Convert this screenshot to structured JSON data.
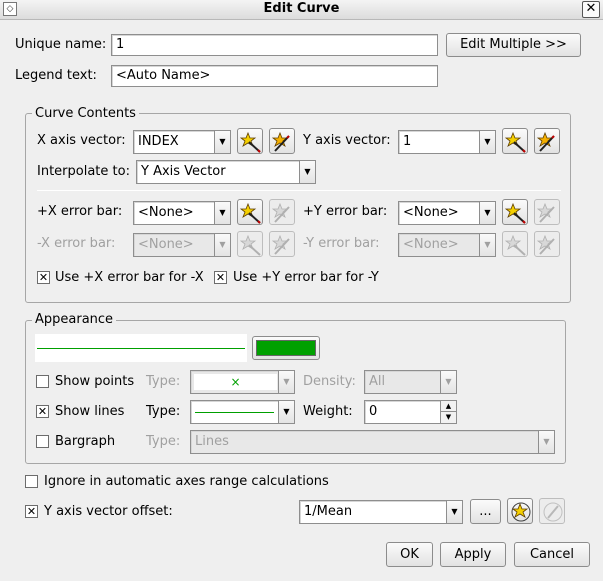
{
  "window": {
    "title": "Edit Curve"
  },
  "general": {
    "unique_name_label": "Unique name:",
    "unique_name_value": "1",
    "edit_multiple_label": "Edit Multiple >>",
    "legend_text_label": "Legend text:",
    "legend_text_value": "<Auto Name>"
  },
  "curve_contents": {
    "title": "Curve Contents",
    "x_axis_label": "X axis vector:",
    "x_axis_value": "INDEX",
    "y_axis_label": "Y axis vector:",
    "y_axis_value": "1",
    "interpolate_label": "Interpolate to:",
    "interpolate_value": "Y Axis Vector",
    "plus_x_error_label": "+X error bar:",
    "plus_x_error_value": "<None>",
    "plus_y_error_label": "+Y error bar:",
    "plus_y_error_value": "<None>",
    "minus_x_error_label": "-X error bar:",
    "minus_x_error_value": "<None>",
    "minus_y_error_label": "-Y error bar:",
    "minus_y_error_value": "<None>",
    "use_plus_x_label": "Use +X error bar for -X",
    "use_plus_x_checked": true,
    "use_plus_y_label": "Use +Y error bar for -Y",
    "use_plus_y_checked": true
  },
  "appearance": {
    "title": "Appearance",
    "color": "#00a000",
    "show_points_label": "Show points",
    "show_points_checked": false,
    "points_type_label": "Type:",
    "points_type_symbol": "×",
    "density_label": "Density:",
    "density_value": "All",
    "show_lines_label": "Show lines",
    "show_lines_checked": true,
    "lines_type_label": "Type:",
    "weight_label": "Weight:",
    "weight_value": "0",
    "bargraph_label": "Bargraph",
    "bargraph_checked": false,
    "bargraph_type_label": "Type:",
    "bargraph_type_value": "Lines"
  },
  "options": {
    "ignore_label": "Ignore in automatic axes range calculations",
    "ignore_checked": false,
    "y_offset_label": "Y axis vector offset:",
    "y_offset_checked": true,
    "y_offset_value": "1/Mean",
    "ellipsis_label": "..."
  },
  "buttons": {
    "ok": "OK",
    "apply": "Apply",
    "cancel": "Cancel"
  },
  "icons": {
    "new_vector": "new-vector-icon (star with wand)",
    "edit_vector": "edit-vector-icon (wand)"
  }
}
